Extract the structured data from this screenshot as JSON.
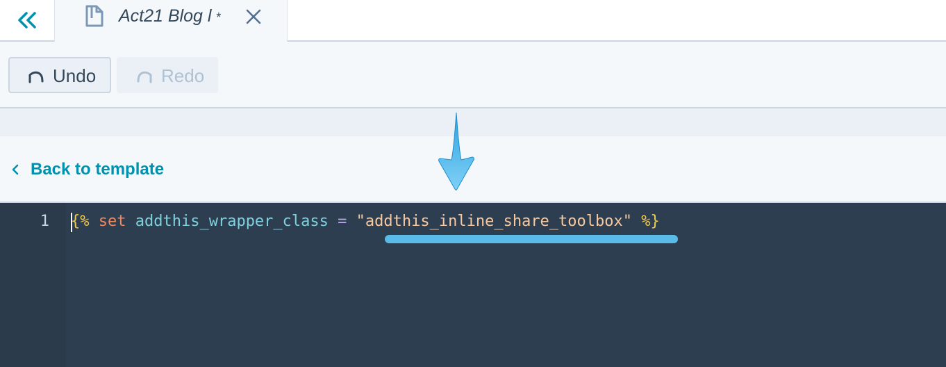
{
  "tabbar": {
    "collapse_icon": "double-chevron-left-icon",
    "tab": {
      "icon": "document-icon",
      "title": "Act21 Blog l",
      "unsaved_marker": "*",
      "close_icon": "close-icon"
    }
  },
  "toolbar": {
    "undo_label": "Undo",
    "redo_label": "Redo",
    "undo_icon": "undo-icon",
    "redo_icon": "redo-icon"
  },
  "navigation": {
    "back_label": "Back to template",
    "back_icon": "chevron-left-icon"
  },
  "editor": {
    "line_number": "1",
    "tokens": {
      "open": "{%",
      "keyword": "set",
      "variable": "addthis_wrapper_class",
      "operator": "=",
      "string": "\"addthis_inline_share_toolbox\"",
      "close": "%}"
    }
  },
  "colors": {
    "accent": "#0091ae",
    "editor_bg": "#2d3e50",
    "annotation": "#5bbbe8"
  }
}
